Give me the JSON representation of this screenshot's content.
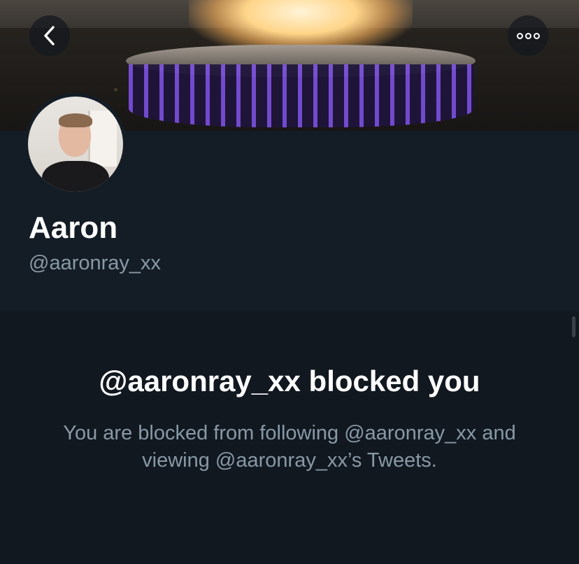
{
  "profile": {
    "name": "Aaron",
    "handle": "@aaronray_xx"
  },
  "blocked": {
    "title": "@aaronray_xx blocked you",
    "description": "You are blocked from following @aaronray_xx and viewing @aaronray_xx’s Tweets."
  },
  "icons": {
    "back": "chevron-left-icon",
    "more": "more-options-icon"
  },
  "colors": {
    "background": "#141d26",
    "blocked_background": "#111820",
    "primary_text": "#ffffff",
    "secondary_text": "#8899a6"
  }
}
